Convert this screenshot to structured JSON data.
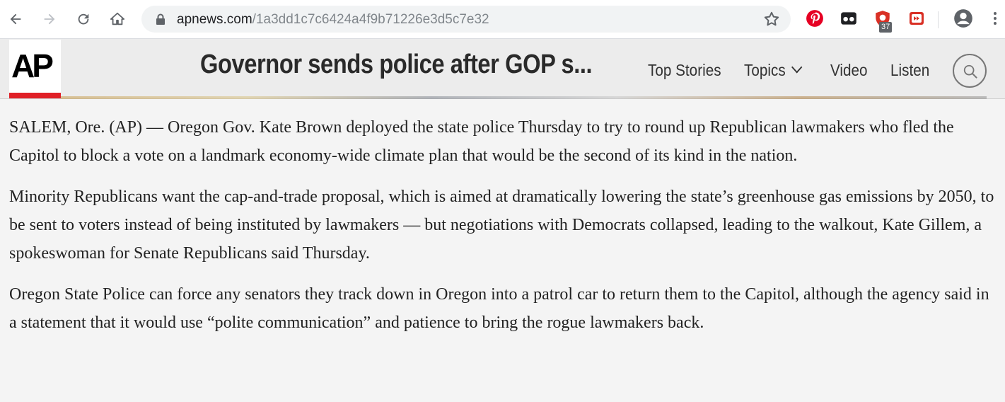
{
  "browser": {
    "url_domain": "apnews.com",
    "url_path": "/1a3dd1c7c6424a4f9b71226e3d5c7e32",
    "extension_badge": "37",
    "icons": [
      "back-icon",
      "forward-icon",
      "reload-icon",
      "home-icon",
      "lock-icon",
      "star-icon",
      "pinterest-icon",
      "incognito-extension-icon",
      "ublock-icon",
      "video-extension-icon",
      "profile-icon",
      "menu-icon"
    ],
    "colors": {
      "pinterest": "#e60023",
      "extension_red": "#d93025"
    }
  },
  "site": {
    "logo": "AP",
    "headline": "Governor sends police after GOP s...",
    "nav": [
      "Top Stories",
      "Topics",
      "Video",
      "Listen"
    ],
    "accent_color": "#e01f26"
  },
  "article": {
    "paragraphs": [
      "SALEM, Ore. (AP) — Oregon Gov. Kate Brown deployed the state police Thursday to try to round up Republican lawmakers who fled the Capitol to block a vote on a landmark economy-wide climate plan that would be the second of its kind in the nation.",
      "Minority Republicans want the cap-and-trade proposal, which is aimed at dramatically lowering the state’s greenhouse gas emissions by 2050, to be sent to voters instead of being instituted by lawmakers — but negotiations with Democrats collapsed, leading to the walkout, Kate Gillem, a spokeswoman for Senate Republicans said Thursday.",
      "Oregon State Police can force any senators they track down in Oregon into a patrol car to return them to the Capitol, although the agency said in a statement that it would use “polite communication” and patience to bring the rogue lawmakers back."
    ]
  }
}
